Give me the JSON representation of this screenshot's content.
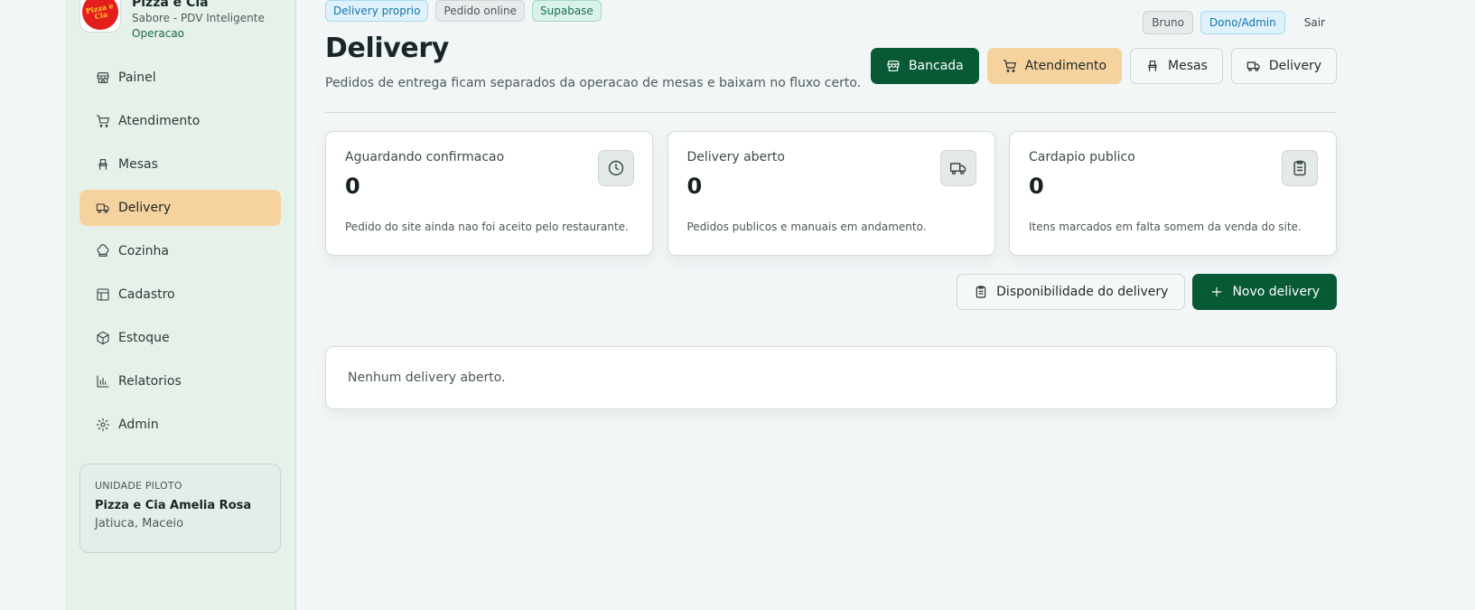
{
  "brand": {
    "name": "Pizza e Cia",
    "subtitle": "Sabore - PDV Inteligente",
    "mode": "Operacao",
    "logo_text": "Pizza e Cia"
  },
  "sidebar": {
    "items": [
      {
        "label": "Painel",
        "icon": "store-icon"
      },
      {
        "label": "Atendimento",
        "icon": "cart-icon"
      },
      {
        "label": "Mesas",
        "icon": "chair-icon"
      },
      {
        "label": "Delivery",
        "icon": "truck-icon",
        "active": true
      },
      {
        "label": "Cozinha",
        "icon": "chef-hat-icon"
      },
      {
        "label": "Cadastro",
        "icon": "layout-icon"
      },
      {
        "label": "Estoque",
        "icon": "box-icon"
      },
      {
        "label": "Relatorios",
        "icon": "bar-chart-icon"
      },
      {
        "label": "Admin",
        "icon": "gear-icon"
      }
    ],
    "unit": {
      "tag": "UNIDADE PILOTO",
      "name": "Pizza e Cia Amelia Rosa",
      "location": "Jatiuca, Maceio"
    }
  },
  "header": {
    "badges": [
      "Delivery proprio",
      "Pedido online",
      "Supabase"
    ],
    "user": "Bruno",
    "role": "Dono/Admin",
    "logout": "Sair",
    "title": "Delivery",
    "description": "Pedidos de entrega ficam separados da operacao de mesas e baixam no fluxo certo."
  },
  "quick_actions": {
    "bancada": "Bancada",
    "atendimento": "Atendimento",
    "mesas": "Mesas",
    "delivery": "Delivery"
  },
  "stats": [
    {
      "label": "Aguardando confirmacao",
      "value": "0",
      "note": "Pedido do site ainda nao foi aceito pelo restaurante.",
      "icon": "clock-icon"
    },
    {
      "label": "Delivery aberto",
      "value": "0",
      "note": "Pedidos publicos e manuais em andamento.",
      "icon": "truck-icon"
    },
    {
      "label": "Cardapio publico",
      "value": "0",
      "note": "Itens marcados em falta somem da venda do site.",
      "icon": "clipboard-icon"
    }
  ],
  "actions": {
    "availability": "Disponibilidade do delivery",
    "new_delivery": "Novo delivery"
  },
  "empty_state": "Nenhum delivery aberto.",
  "colors": {
    "primary": "#075a35",
    "accent": "#f6d29f",
    "sidebar_bg": "#e6f1ea"
  }
}
